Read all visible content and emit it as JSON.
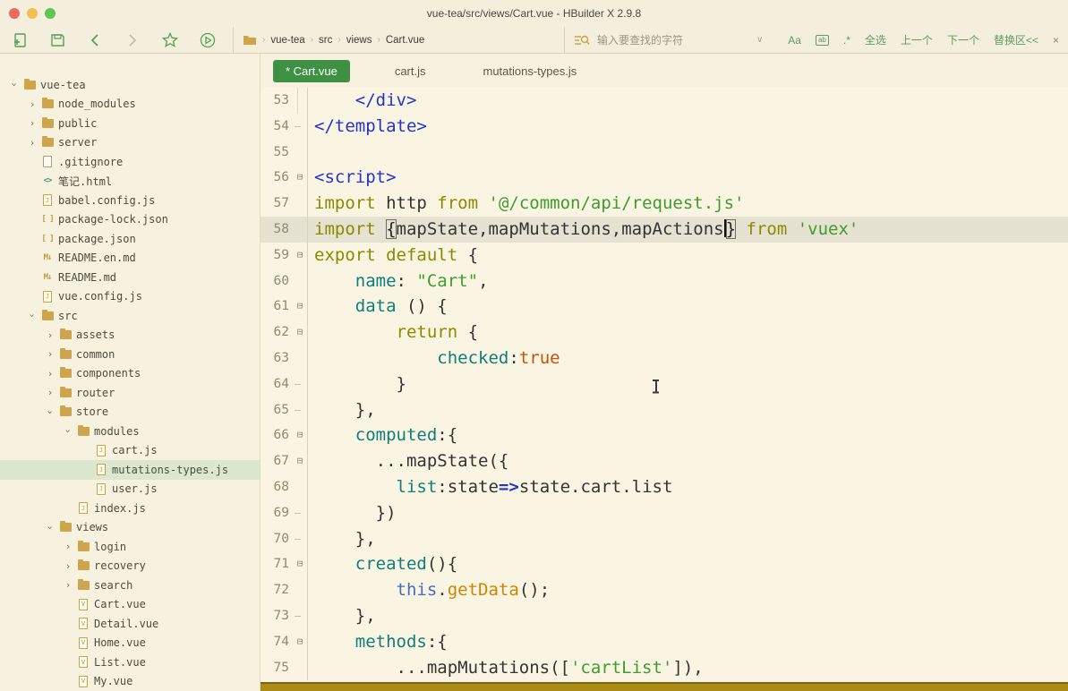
{
  "window": {
    "title": "vue-tea/src/views/Cart.vue - HBuilder X 2.9.8"
  },
  "colors": {
    "accent_green": "#3e9142",
    "gold": "#c9a348",
    "bottom_bar": "#ab8c17",
    "tree_selection_bg": "#dbe8cf",
    "current_line_bg": "#e6e2d2",
    "syntax": {
      "tag": "#2433c8",
      "keyword": "#8a8a00",
      "string": "#3f9b2e",
      "property": "#0f7d7b",
      "boolean": "#c2500f",
      "this": "#3f6ec4",
      "function": "#cd8500",
      "plain": "#333333"
    }
  },
  "toolbar": {
    "icons": [
      {
        "name": "new-file-button",
        "icon": "new-file-icon",
        "disabled": false
      },
      {
        "name": "save-button",
        "icon": "save-icon",
        "disabled": false
      },
      {
        "name": "back-button",
        "icon": "back-icon",
        "disabled": false
      },
      {
        "name": "forward-button",
        "icon": "forward-icon",
        "disabled": true
      },
      {
        "name": "favorite-button",
        "icon": "star-icon",
        "disabled": false
      },
      {
        "name": "run-button",
        "icon": "run-icon",
        "disabled": false
      }
    ],
    "breadcrumb": [
      "vue-tea",
      "src",
      "views",
      "Cart.vue"
    ],
    "search": {
      "placeholder": "输入要查找的字符",
      "actions": [
        {
          "name": "match-case-button",
          "label": "Aa",
          "boxed": false,
          "gray": false
        },
        {
          "name": "whole-word-button",
          "label": "ab",
          "boxed": true,
          "gray": false
        },
        {
          "name": "regex-button",
          "label": ".*",
          "boxed": false,
          "gray": false
        },
        {
          "name": "select-all-button",
          "label": "全选",
          "boxed": false,
          "gray": false
        },
        {
          "name": "previous-button",
          "label": "上一个",
          "boxed": false,
          "gray": false
        },
        {
          "name": "next-button",
          "label": "下一个",
          "boxed": false,
          "gray": false
        },
        {
          "name": "replace-panel-button",
          "label": "替换区<<",
          "boxed": false,
          "gray": false
        },
        {
          "name": "close-search-button",
          "label": "×",
          "boxed": false,
          "gray": true
        }
      ]
    }
  },
  "sidebar": {
    "items": [
      {
        "label": "vue-tea",
        "depth": 0,
        "icon": "folder",
        "chev": "open",
        "selected": false
      },
      {
        "label": "node_modules",
        "depth": 1,
        "icon": "folder",
        "chev": "closed",
        "selected": false
      },
      {
        "label": "public",
        "depth": 1,
        "icon": "folder",
        "chev": "closed",
        "selected": false
      },
      {
        "label": "server",
        "depth": 1,
        "icon": "folder",
        "chev": "closed",
        "selected": false
      },
      {
        "label": ".gitignore",
        "depth": 1,
        "icon": "file",
        "chev": "none",
        "selected": false
      },
      {
        "label": "笔记.html",
        "depth": 1,
        "icon": "html",
        "chev": "none",
        "selected": false
      },
      {
        "label": "babel.config.js",
        "depth": 1,
        "icon": "js",
        "chev": "none",
        "selected": false
      },
      {
        "label": "package-lock.json",
        "depth": 1,
        "icon": "json",
        "chev": "none",
        "selected": false
      },
      {
        "label": "package.json",
        "depth": 1,
        "icon": "json",
        "chev": "none",
        "selected": false
      },
      {
        "label": "README.en.md",
        "depth": 1,
        "icon": "md",
        "chev": "none",
        "selected": false
      },
      {
        "label": "README.md",
        "depth": 1,
        "icon": "md",
        "chev": "none",
        "selected": false
      },
      {
        "label": "vue.config.js",
        "depth": 1,
        "icon": "js",
        "chev": "none",
        "selected": false
      },
      {
        "label": "src",
        "depth": 1,
        "icon": "folder",
        "chev": "open",
        "selected": false
      },
      {
        "label": "assets",
        "depth": 2,
        "icon": "folder",
        "chev": "closed",
        "selected": false
      },
      {
        "label": "common",
        "depth": 2,
        "icon": "folder",
        "chev": "closed",
        "selected": false
      },
      {
        "label": "components",
        "depth": 2,
        "icon": "folder",
        "chev": "closed",
        "selected": false
      },
      {
        "label": "router",
        "depth": 2,
        "icon": "folder",
        "chev": "closed",
        "selected": false
      },
      {
        "label": "store",
        "depth": 2,
        "icon": "folder",
        "chev": "open",
        "selected": false
      },
      {
        "label": "modules",
        "depth": 3,
        "icon": "folder",
        "chev": "open",
        "selected": false
      },
      {
        "label": "cart.js",
        "depth": 4,
        "icon": "js",
        "chev": "none",
        "selected": false
      },
      {
        "label": "mutations-types.js",
        "depth": 4,
        "icon": "js",
        "chev": "none",
        "selected": true
      },
      {
        "label": "user.js",
        "depth": 4,
        "icon": "js",
        "chev": "none",
        "selected": false
      },
      {
        "label": "index.js",
        "depth": 3,
        "icon": "js",
        "chev": "none",
        "selected": false
      },
      {
        "label": "views",
        "depth": 2,
        "icon": "folder",
        "chev": "open",
        "selected": false
      },
      {
        "label": "login",
        "depth": 3,
        "icon": "folder",
        "chev": "closed",
        "selected": false
      },
      {
        "label": "recovery",
        "depth": 3,
        "icon": "folder",
        "chev": "closed",
        "selected": false
      },
      {
        "label": "search",
        "depth": 3,
        "icon": "folder",
        "chev": "closed",
        "selected": false
      },
      {
        "label": "Cart.vue",
        "depth": 3,
        "icon": "vue",
        "chev": "none",
        "selected": false
      },
      {
        "label": "Detail.vue",
        "depth": 3,
        "icon": "vue",
        "chev": "none",
        "selected": false
      },
      {
        "label": "Home.vue",
        "depth": 3,
        "icon": "vue",
        "chev": "none",
        "selected": false
      },
      {
        "label": "List.vue",
        "depth": 3,
        "icon": "vue",
        "chev": "none",
        "selected": false
      },
      {
        "label": "My.vue",
        "depth": 3,
        "icon": "vue",
        "chev": "none",
        "selected": false
      }
    ]
  },
  "editor": {
    "tabs": [
      {
        "label": "* Cart.vue",
        "active": true
      },
      {
        "label": "cart.js",
        "active": false
      },
      {
        "label": "mutations-types.js",
        "active": false
      }
    ],
    "lines": [
      {
        "n": 53,
        "fold": "bar",
        "cur": false,
        "t": [
          [
            "plain",
            "    "
          ],
          [
            "tag",
            "</div>"
          ]
        ]
      },
      {
        "n": 54,
        "fold": "dash",
        "cur": false,
        "t": [
          [
            "tag",
            "</template>"
          ]
        ]
      },
      {
        "n": 55,
        "fold": "none",
        "cur": false,
        "t": []
      },
      {
        "n": 56,
        "fold": "open",
        "cur": false,
        "t": [
          [
            "tag",
            "<script>"
          ]
        ]
      },
      {
        "n": 57,
        "fold": "none",
        "cur": false,
        "t": [
          [
            "kw",
            "import"
          ],
          [
            "plain",
            " http "
          ],
          [
            "kw",
            "from"
          ],
          [
            "plain",
            " "
          ],
          [
            "str",
            "'@/common/api/request.js'"
          ]
        ]
      },
      {
        "n": 58,
        "fold": "none",
        "cur": true,
        "t": [
          [
            "kw",
            "import"
          ],
          [
            "plain",
            " "
          ],
          [
            "brk",
            "{"
          ],
          [
            "plain",
            "mapState,mapMutations,mapActions"
          ],
          [
            "caret",
            ""
          ],
          [
            "brk",
            "}"
          ],
          [
            "plain",
            " "
          ],
          [
            "kw",
            "from"
          ],
          [
            "plain",
            " "
          ],
          [
            "str",
            "'vuex'"
          ]
        ]
      },
      {
        "n": 59,
        "fold": "open",
        "cur": false,
        "t": [
          [
            "kw",
            "export"
          ],
          [
            "plain",
            " "
          ],
          [
            "kw",
            "default"
          ],
          [
            "plain",
            " {"
          ]
        ]
      },
      {
        "n": 60,
        "fold": "none",
        "cur": false,
        "t": [
          [
            "plain",
            "    "
          ],
          [
            "prop",
            "name"
          ],
          [
            "plain",
            ": "
          ],
          [
            "str",
            "\"Cart\""
          ],
          [
            "plain",
            ","
          ]
        ]
      },
      {
        "n": 61,
        "fold": "open",
        "cur": false,
        "t": [
          [
            "plain",
            "    "
          ],
          [
            "prop",
            "data"
          ],
          [
            "plain",
            " () {"
          ]
        ]
      },
      {
        "n": 62,
        "fold": "open",
        "cur": false,
        "t": [
          [
            "plain",
            "        "
          ],
          [
            "kw",
            "return"
          ],
          [
            "plain",
            " {"
          ]
        ]
      },
      {
        "n": 63,
        "fold": "none",
        "cur": false,
        "t": [
          [
            "plain",
            "            "
          ],
          [
            "prop",
            "checked"
          ],
          [
            "plain",
            ":"
          ],
          [
            "bool",
            "true"
          ]
        ]
      },
      {
        "n": 64,
        "fold": "dash",
        "cur": false,
        "t": [
          [
            "plain",
            "        }"
          ]
        ]
      },
      {
        "n": 65,
        "fold": "dash",
        "cur": false,
        "t": [
          [
            "plain",
            "    },"
          ]
        ]
      },
      {
        "n": 66,
        "fold": "open",
        "cur": false,
        "t": [
          [
            "plain",
            "    "
          ],
          [
            "prop",
            "computed"
          ],
          [
            "plain",
            ":{"
          ]
        ]
      },
      {
        "n": 67,
        "fold": "open",
        "cur": false,
        "t": [
          [
            "plain",
            "      ...mapState({"
          ]
        ]
      },
      {
        "n": 68,
        "fold": "none",
        "cur": false,
        "t": [
          [
            "plain",
            "        "
          ],
          [
            "prop",
            "list"
          ],
          [
            "plain",
            ":state"
          ],
          [
            "arrow",
            "=>"
          ],
          [
            "plain",
            "state.cart.list"
          ]
        ]
      },
      {
        "n": 69,
        "fold": "dash",
        "cur": false,
        "t": [
          [
            "plain",
            "      })"
          ]
        ]
      },
      {
        "n": 70,
        "fold": "dash",
        "cur": false,
        "t": [
          [
            "plain",
            "    },"
          ]
        ]
      },
      {
        "n": 71,
        "fold": "open",
        "cur": false,
        "t": [
          [
            "plain",
            "    "
          ],
          [
            "prop",
            "created"
          ],
          [
            "plain",
            "(){"
          ]
        ]
      },
      {
        "n": 72,
        "fold": "none",
        "cur": false,
        "t": [
          [
            "plain",
            "        "
          ],
          [
            "this",
            "this"
          ],
          [
            "plain",
            "."
          ],
          [
            "fn",
            "getData"
          ],
          [
            "plain",
            "();"
          ]
        ]
      },
      {
        "n": 73,
        "fold": "dash",
        "cur": false,
        "t": [
          [
            "plain",
            "    },"
          ]
        ]
      },
      {
        "n": 74,
        "fold": "open",
        "cur": false,
        "t": [
          [
            "plain",
            "    "
          ],
          [
            "prop",
            "methods"
          ],
          [
            "plain",
            ":{"
          ]
        ]
      },
      {
        "n": 75,
        "fold": "none",
        "cur": false,
        "t": [
          [
            "plain",
            "        ...mapMutations(["
          ],
          [
            "str",
            "'cartList'"
          ],
          [
            "plain",
            "]),"
          ]
        ]
      }
    ]
  }
}
